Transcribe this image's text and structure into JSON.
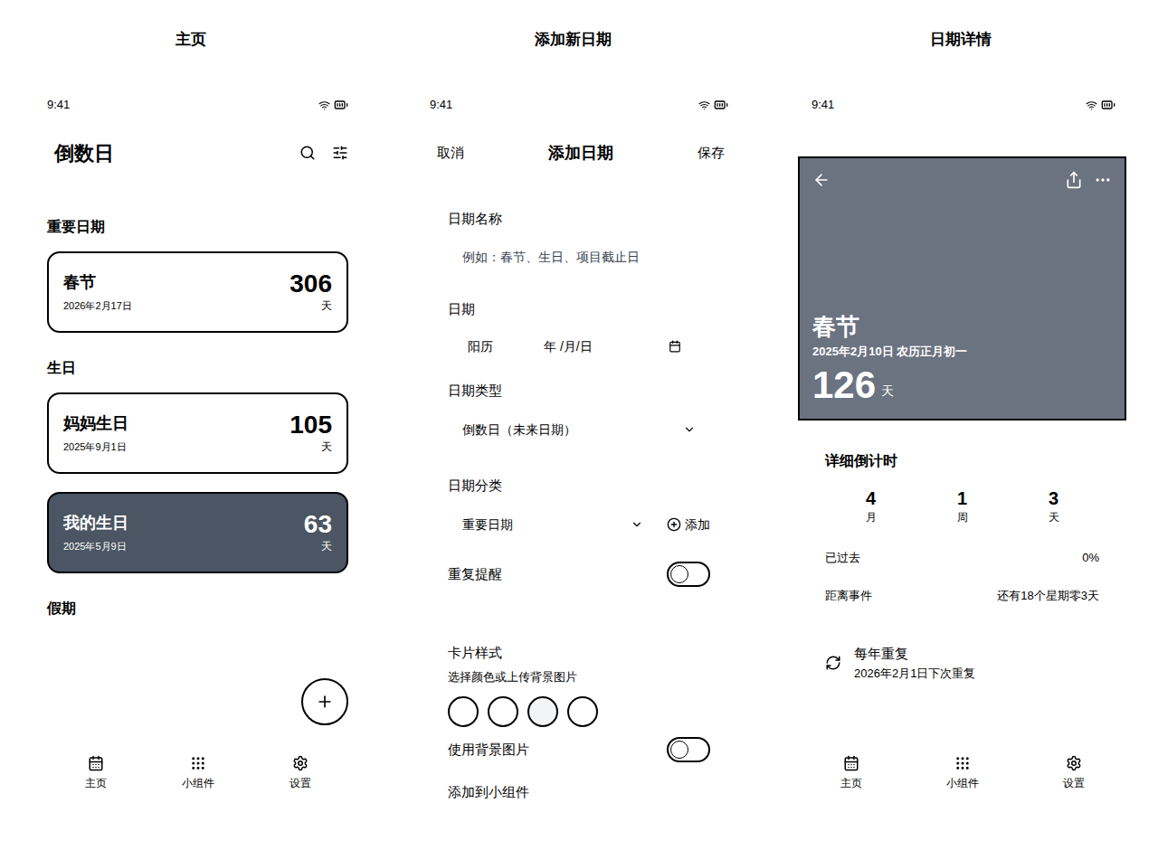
{
  "home": {
    "caption": "主页",
    "time": "9:41",
    "title": "倒数日",
    "sections": [
      {
        "title": "重要日期",
        "cards": [
          {
            "name": "春节",
            "date": "2026年2月17日",
            "days": "306",
            "unit": "天",
            "kind": "plain"
          }
        ]
      },
      {
        "title": "生日",
        "cards": [
          {
            "name": "妈妈生日",
            "date": "2025年9月1日",
            "days": "105",
            "unit": "天",
            "kind": "plain"
          },
          {
            "name": "我的生日",
            "date": "2025年5月9日",
            "days": "63",
            "unit": "天",
            "kind": "image"
          }
        ]
      },
      {
        "title": "假期",
        "cards": []
      }
    ]
  },
  "add": {
    "caption": "添加新日期",
    "time": "9:41",
    "cancel": "取消",
    "title": "添加日期",
    "save": "保存",
    "name_label": "日期名称",
    "name_placeholder": "例如：春节、生日、项目截止日",
    "date_label": "日期",
    "calendar_type": "阳历",
    "date_placeholder": "年 /月/日",
    "type_label": "日期类型",
    "type_value": "倒数日（未来日期）",
    "category_label": "日期分类",
    "category_value": "重要日期",
    "add_category": "添加",
    "repeat": {
      "label": "重复提醒",
      "on": false
    },
    "style_label": "卡片样式",
    "style_hint": "选择颜色或上传背景图片",
    "colors": [
      {
        "color": "#ffffff",
        "selected": false
      },
      {
        "color": "#ffffff",
        "selected": false
      },
      {
        "color": "#f3f4f6",
        "selected": false
      },
      {
        "color": "#ffffff",
        "selected": false
      }
    ],
    "background": {
      "label": "使用背景图片",
      "on": false
    },
    "widget_label": "添加到小组件"
  },
  "detail": {
    "caption": "日期详情",
    "time": "9:41",
    "name": "春节",
    "date": "2025年2月10日 农历正月初一",
    "days": "126",
    "unit": "天",
    "countdown_title": "详细倒计时",
    "breakdown": [
      {
        "value": "4",
        "unit": "月"
      },
      {
        "value": "1",
        "unit": "周"
      },
      {
        "value": "3",
        "unit": "天"
      }
    ],
    "stats": [
      {
        "label": "已过去",
        "value": "0%"
      },
      {
        "label": "距离事件",
        "value": "还有18个星期零3天"
      }
    ],
    "repeat": {
      "title": "每年重复",
      "next": "2026年2月1日下次重复"
    }
  },
  "nav": [
    {
      "label": "主页"
    },
    {
      "label": "小组件"
    },
    {
      "label": "设置"
    }
  ]
}
